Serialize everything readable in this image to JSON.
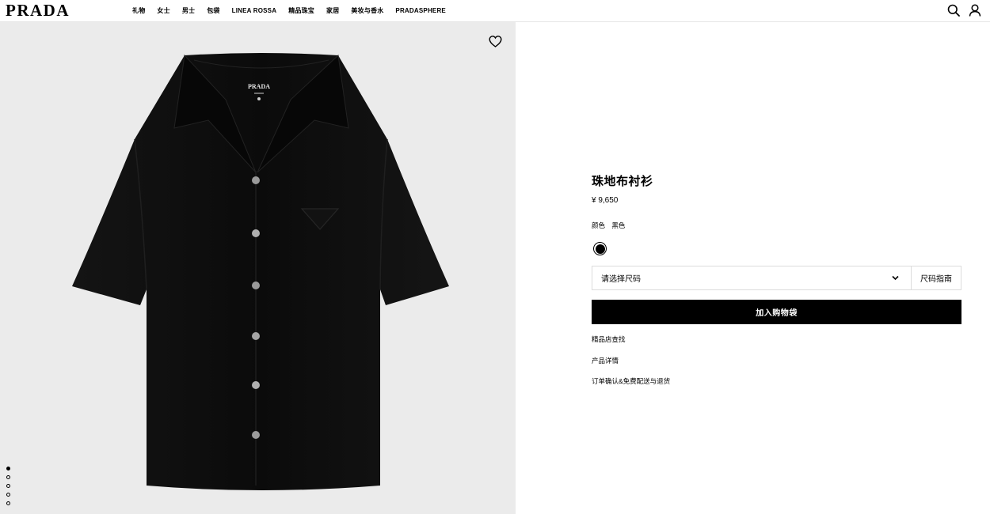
{
  "brand": {
    "logo_text": "PRADA"
  },
  "nav": {
    "items": [
      {
        "label": "礼物"
      },
      {
        "label": "女士"
      },
      {
        "label": "男士"
      },
      {
        "label": "包袋"
      },
      {
        "label": "LINEA ROSSA"
      },
      {
        "label": "精品珠宝"
      },
      {
        "label": "家居"
      },
      {
        "label": "美妆与香水"
      },
      {
        "label": "PRADASPHERE"
      }
    ]
  },
  "header_icons": [
    "search-icon",
    "user-icon"
  ],
  "gallery": {
    "image_count": 5,
    "active_index": 0,
    "shirt_label_text": "PRADA",
    "colors": {
      "background": "#ebebeb",
      "shirt": "#0d0d0d"
    }
  },
  "product": {
    "title": "珠地布衬衫",
    "price": "¥ 9,650",
    "color_label": "颜色",
    "color_value": "黑色",
    "swatch_color": "#000000",
    "size_placeholder": "请选择尺码",
    "size_guide": "尺码指南",
    "add_to_bag": "加入购物袋",
    "links": [
      {
        "label": "精品店查找"
      },
      {
        "label": "产品详情"
      },
      {
        "label": "订单确认&免费配送与退货"
      }
    ]
  }
}
